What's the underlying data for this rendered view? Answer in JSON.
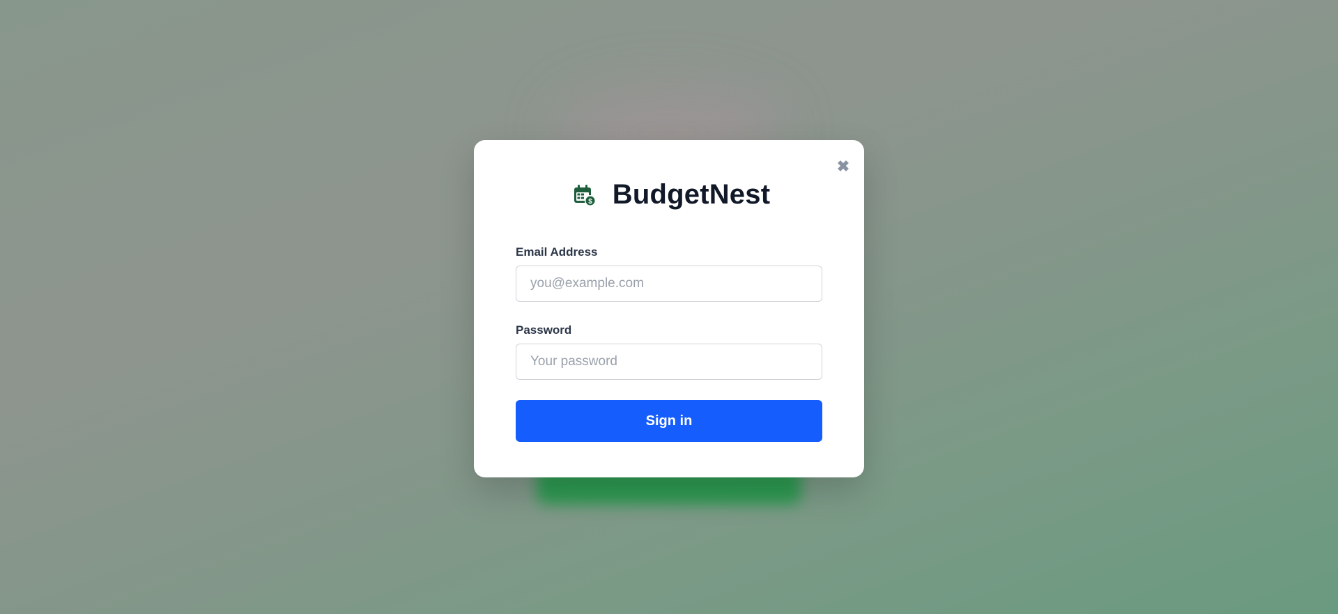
{
  "app": {
    "name": "BudgetNest",
    "logo_icon": "calendar-dollar-icon",
    "brand_color": "#1e5e3c"
  },
  "modal": {
    "close_icon": "close-icon",
    "close_glyph": "✖"
  },
  "form": {
    "email": {
      "label": "Email Address",
      "placeholder": "you@example.com",
      "value": ""
    },
    "password": {
      "label": "Password",
      "placeholder": "Your password",
      "value": ""
    },
    "submit_label": "Sign in",
    "submit_color": "#155dfc"
  }
}
